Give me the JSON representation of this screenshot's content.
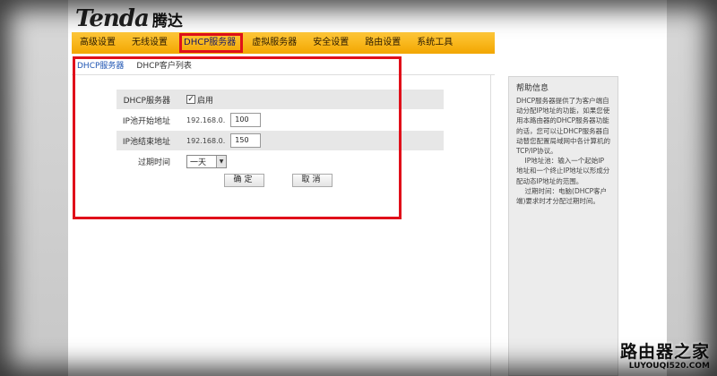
{
  "header": {
    "logo_brand": "Tenda",
    "logo_cn": "腾达"
  },
  "nav": {
    "items": [
      {
        "label": "高级设置"
      },
      {
        "label": "无线设置"
      },
      {
        "label": "DHCP服务器",
        "active": true
      },
      {
        "label": "虚拟服务器"
      },
      {
        "label": "安全设置"
      },
      {
        "label": "路由设置"
      },
      {
        "label": "系统工具"
      }
    ]
  },
  "subnav": {
    "tabs": [
      {
        "label": "DHCP服务器",
        "active": true
      },
      {
        "label": "DHCP客户列表"
      }
    ]
  },
  "form": {
    "dhcp_label": "DHCP服务器",
    "dhcp_enabled": true,
    "dhcp_enable_text": "启用",
    "start_label": "IP池开始地址",
    "start_prefix": "192.168.0.",
    "start_value": "100",
    "end_label": "IP池结束地址",
    "end_prefix": "192.168.0.",
    "end_value": "150",
    "lease_label": "过期时间",
    "lease_value": "一天",
    "confirm_label": "确定",
    "cancel_label": "取消"
  },
  "help": {
    "title": "帮助信息",
    "text": "DHCP服务器提供了为客户端自动分配IP地址的功能，如果您使用本路由器的DHCP服务器功能的话，您可以让DHCP服务器自动替您配置局域网中各计算机的TCP/IP协议。\n    IP地址池：输入一个起始IP地址和一个终止IP地址以形成分配动态IP地址的范围。\n    过期时间：电脑(DHCP客户端)要求时才分配过期时间。"
  },
  "watermark": {
    "cn": "路由器之家",
    "en": "LUYOUQI520.COM"
  },
  "colors": {
    "nav_bg": "#f2a600",
    "highlight": "#e0101a",
    "active_tab": "#1f55b3"
  }
}
